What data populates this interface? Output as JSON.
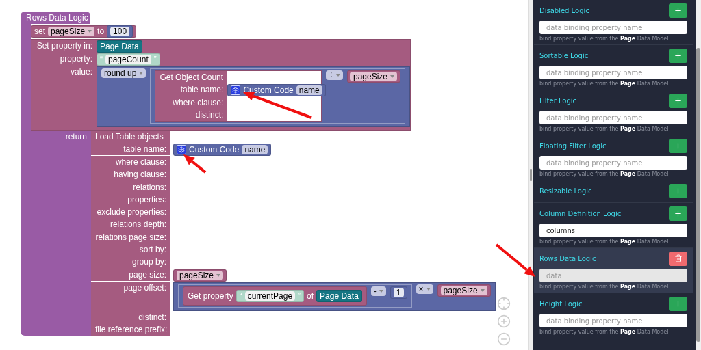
{
  "workspace": {
    "function_block": {
      "name": "Rows Data Logic",
      "set_block": {
        "label": "set",
        "variable": "pageSize",
        "to_label": "to",
        "value": "100"
      },
      "set_property": {
        "label": "Set property in:",
        "target": "Page Data",
        "property_label": "property:",
        "open_quote": "“",
        "property": "pageCount",
        "close_quote": "”",
        "value_label": "value:",
        "round_op": "round up",
        "count_block": {
          "title": "Get Object Count",
          "inputs": [
            {
              "label": "table name:",
              "kind": "custom_code",
              "text": "Custom Code",
              "param": "name"
            },
            {
              "label": "where clause:",
              "kind": "empty"
            },
            {
              "label": "distinct:",
              "kind": "empty"
            }
          ]
        },
        "divide_op": "÷",
        "divisor": "pageSize"
      },
      "return_label": "return",
      "load_block": {
        "title": "Load Table objects",
        "inputs": [
          {
            "label": "table name:",
            "kind": "custom_code",
            "text": "Custom Code",
            "param": "name"
          },
          {
            "label": "where clause:",
            "kind": "empty"
          },
          {
            "label": "having clause:",
            "kind": "empty"
          },
          {
            "label": "relations:",
            "kind": "empty"
          },
          {
            "label": "properties:",
            "kind": "empty"
          },
          {
            "label": "exclude properties:",
            "kind": "empty"
          },
          {
            "label": "relations depth:",
            "kind": "empty"
          },
          {
            "label": "relations page size:",
            "kind": "empty"
          },
          {
            "label": "sort by:",
            "kind": "empty"
          },
          {
            "label": "group by:",
            "kind": "empty"
          },
          {
            "label": "page size:",
            "kind": "variable",
            "variable": "pageSize"
          },
          {
            "label": "page offset:",
            "kind": "offset",
            "get_label": "Get property",
            "open_quote": "“",
            "property": "currentPage",
            "close_quote": "”",
            "of_label": "of",
            "target": "Page Data",
            "minus_op": "-",
            "number": "1",
            "times_op": "×",
            "variable": "pageSize"
          },
          {
            "label": "distinct:",
            "kind": "empty"
          },
          {
            "label": "file reference prefix:",
            "kind": "empty"
          }
        ]
      }
    }
  },
  "logic_panel": {
    "sections": [
      {
        "title": "Disabled Logic",
        "kind": "add",
        "placeholder": "data binding property name",
        "disabled": false,
        "help": "bind property value from the **Page** Data Model",
        "selected": false
      },
      {
        "title": "Sortable Logic",
        "kind": "add",
        "placeholder": "data binding property name",
        "disabled": false,
        "help": "bind property value from the **Page** Data Model",
        "selected": false
      },
      {
        "title": "Filter Logic",
        "kind": "add",
        "placeholder": "data binding property name",
        "disabled": false,
        "help": "bind property value from the **Page** Data Model",
        "selected": false
      },
      {
        "title": "Floating Filter Logic",
        "kind": "add",
        "placeholder": "data binding property name",
        "disabled": false,
        "help": "bind property value from the **Page** Data Model",
        "selected": false
      },
      {
        "title": "Resizable Logic",
        "kind": "add",
        "selected": false
      },
      {
        "title": "Column Definition Logic",
        "kind": "add",
        "value": "columns",
        "disabled": false,
        "help": "bind property value from the **Page** Data Model",
        "selected": false
      },
      {
        "title": "Rows Data Logic",
        "kind": "delete",
        "value": "data",
        "disabled": true,
        "help": "bind property value from the **Page** Data Model",
        "selected": true
      },
      {
        "title": "Height Logic",
        "kind": "add",
        "placeholder": "data binding property name",
        "disabled": false,
        "help": "bind property value from the **Page** Data Model",
        "selected": false
      }
    ]
  }
}
